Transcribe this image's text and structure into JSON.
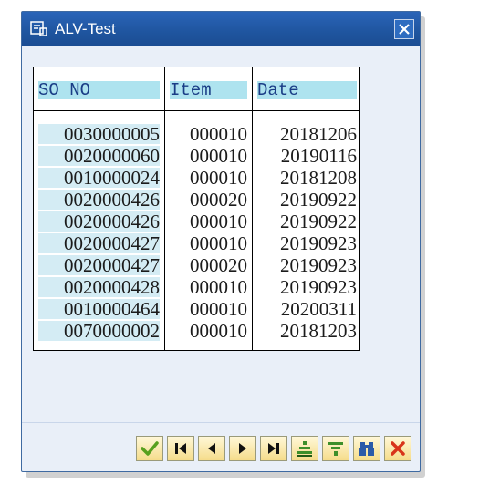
{
  "window": {
    "title": "ALV-Test"
  },
  "grid": {
    "columns": [
      "SO NO",
      "Item",
      "Date"
    ],
    "rows": [
      [
        "0030000005",
        "000010",
        "20181206"
      ],
      [
        "0020000060",
        "000010",
        "20190116"
      ],
      [
        "0010000024",
        "000010",
        "20181208"
      ],
      [
        "0020000426",
        "000020",
        "20190922"
      ],
      [
        "0020000426",
        "000010",
        "20190922"
      ],
      [
        "0020000427",
        "000010",
        "20190923"
      ],
      [
        "0020000427",
        "000020",
        "20190923"
      ],
      [
        "0020000428",
        "000010",
        "20190923"
      ],
      [
        "0010000464",
        "000010",
        "20200311"
      ],
      [
        "0070000002",
        "000010",
        "20181203"
      ]
    ]
  },
  "toolbar": {
    "buttons": [
      {
        "name": "confirm-button",
        "icon": "checkmark-icon"
      },
      {
        "name": "first-page-button",
        "icon": "first-page-icon"
      },
      {
        "name": "previous-page-button",
        "icon": "previous-page-icon"
      },
      {
        "name": "next-page-button",
        "icon": "next-page-icon"
      },
      {
        "name": "last-page-button",
        "icon": "last-page-icon"
      },
      {
        "name": "sort-button",
        "icon": "sort-icon"
      },
      {
        "name": "filter-button",
        "icon": "filter-icon"
      },
      {
        "name": "find-button",
        "icon": "binoculars-icon"
      },
      {
        "name": "cancel-button",
        "icon": "cancel-icon"
      }
    ]
  },
  "colors": {
    "titlebar": "#1f559f",
    "header_bg": "#aee3ef",
    "key_col_bg": "#d4ecf4",
    "accent_green": "#58a01e",
    "accent_red": "#d8341a"
  }
}
